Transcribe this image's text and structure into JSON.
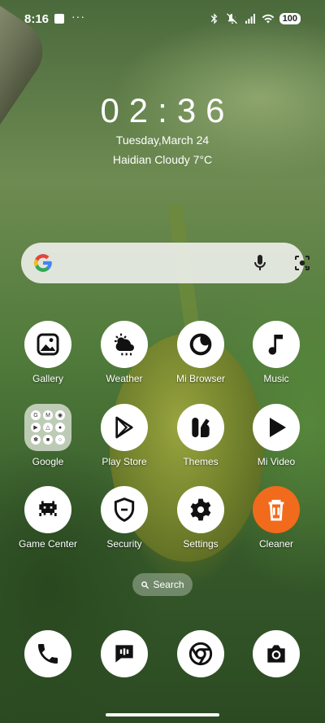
{
  "statusbar": {
    "time": "8:16",
    "dots": "···",
    "battery": "100",
    "icons": [
      "bluetooth-icon",
      "mute-icon",
      "signal-icon",
      "wifi-icon"
    ]
  },
  "clock": {
    "time": "02:36",
    "date": "Tuesday,March 24",
    "weather": "Haidian Cloudy 7°C"
  },
  "search": {
    "icons": [
      "google-icon",
      "mic-icon",
      "lens-icon"
    ],
    "pill_label": "Search"
  },
  "apps": [
    {
      "label": "Gallery",
      "icon": "gallery-icon"
    },
    {
      "label": "Weather",
      "icon": "weather-icon"
    },
    {
      "label": "Mi Browser",
      "icon": "browser-icon"
    },
    {
      "label": "Music",
      "icon": "music-icon"
    },
    {
      "label": "Google",
      "icon": "google-folder-icon"
    },
    {
      "label": "Play Store",
      "icon": "play-store-icon"
    },
    {
      "label": "Themes",
      "icon": "themes-icon"
    },
    {
      "label": "Mi Video",
      "icon": "video-icon"
    },
    {
      "label": "Game Center",
      "icon": "game-icon"
    },
    {
      "label": "Security",
      "icon": "security-icon"
    },
    {
      "label": "Settings",
      "icon": "settings-icon"
    },
    {
      "label": "Cleaner",
      "icon": "cleaner-icon"
    }
  ],
  "dock": [
    "phone-icon",
    "messages-icon",
    "chrome-icon",
    "camera-icon"
  ],
  "colors": {
    "cleaner_accent": "#f26a1b",
    "icon_bg": "#ffffff",
    "glyph": "#111111"
  }
}
